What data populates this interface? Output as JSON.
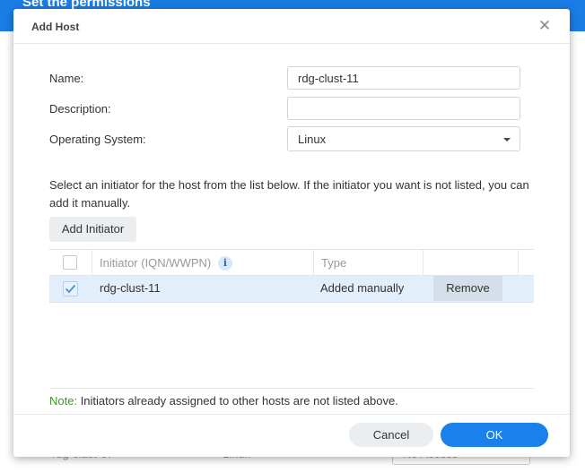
{
  "background": {
    "title": "Set the permissions",
    "row": {
      "name": "rdg-clust-07",
      "os": "Linux",
      "permission": "No Access"
    }
  },
  "dialog": {
    "title": "Add Host",
    "close_icon": "close-icon",
    "form": {
      "name_label": "Name:",
      "name_value": "rdg-clust-11",
      "description_label": "Description:",
      "description_value": "",
      "os_label": "Operating System:",
      "os_value": "Linux"
    },
    "instructions": "Select an initiator for the host from the list below. If the initiator you want is not listed, you can add it manually.",
    "add_initiator_label": "Add Initiator",
    "grid": {
      "headers": {
        "initiator": "Initiator (IQN/WWPN)",
        "type": "Type"
      },
      "info_icon": "info-icon",
      "rows": [
        {
          "checked": true,
          "initiator": "rdg-clust-11",
          "type": "Added manually",
          "action": "Remove"
        }
      ]
    },
    "note": {
      "label": "Note:",
      "text": " Initiators already assigned to other hosts are not listed above."
    },
    "buttons": {
      "cancel": "Cancel",
      "ok": "OK"
    }
  },
  "colors": {
    "accent": "#1a80ec",
    "selected_row": "#e3eefb",
    "note": "#3a9a25"
  }
}
